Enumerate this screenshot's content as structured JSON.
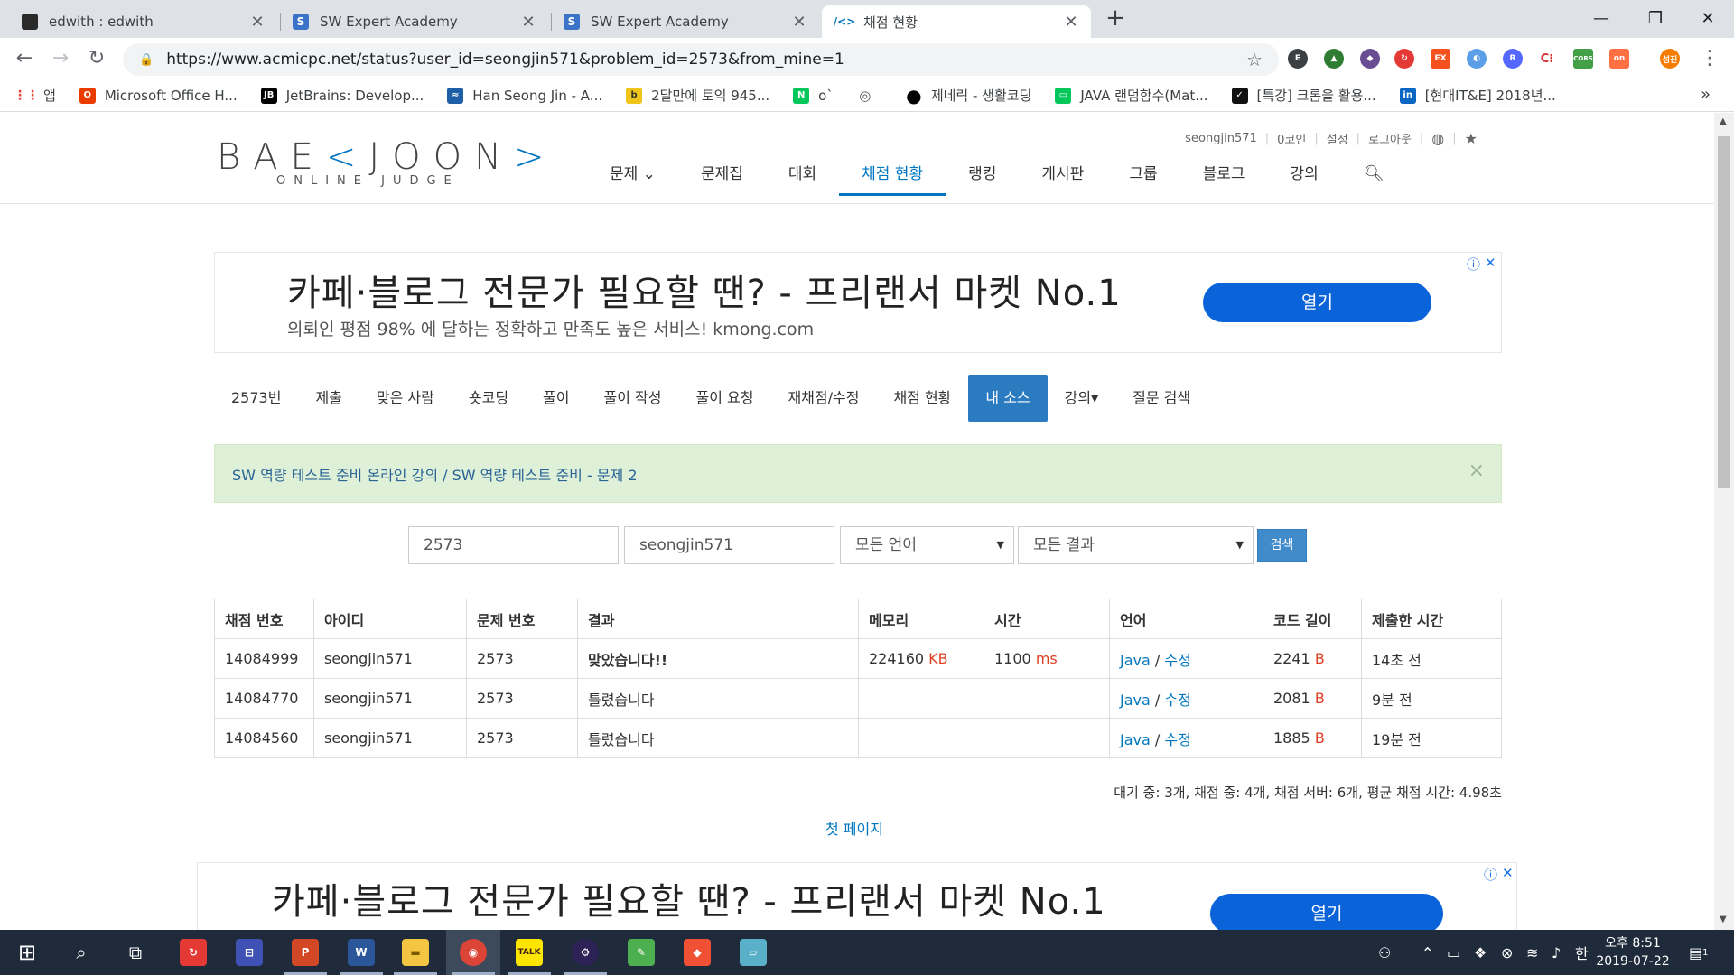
{
  "browser": {
    "tabs": [
      {
        "title": "edwith : edwith",
        "icon": "edwith-icon",
        "color": "#2a2a2a",
        "glyph": ""
      },
      {
        "title": "SW Expert Academy",
        "icon": "swea-icon",
        "color": "#3b73c8",
        "glyph": "S"
      },
      {
        "title": "SW Expert Academy",
        "icon": "swea-icon",
        "color": "#3b73c8",
        "glyph": "S"
      },
      {
        "title": "채점 현황",
        "icon": "baekjoon-icon",
        "color": "#0076c0",
        "glyph": "/<>"
      }
    ],
    "url": "https://www.acmicpc.net/status?user_id=seongjin571&problem_id=2573&from_mine=1",
    "bookmarks": [
      {
        "label": "앱",
        "icon": "apps-icon",
        "color": "#e94235",
        "glyph": "⋮⋮"
      },
      {
        "label": "Microsoft Office H...",
        "icon": "office-icon",
        "color": "#eb3c00",
        "glyph": "O"
      },
      {
        "label": "JetBrains: Develop...",
        "icon": "jetbrains-icon",
        "color": "#000000",
        "glyph": "JB"
      },
      {
        "label": "Han Seong Jin - A...",
        "icon": "codility-icon",
        "color": "#1f5fa8",
        "glyph": "≈"
      },
      {
        "label": "2달만에 토익 945...",
        "icon": "blog-icon",
        "color": "#f0c419",
        "glyph": "b"
      },
      {
        "label": "o`",
        "icon": "naver-icon",
        "color": "#03c75a",
        "glyph": "N"
      },
      {
        "label": "",
        "icon": "globe-icon",
        "color": "#555555",
        "glyph": "◎"
      },
      {
        "label": "제네릭 - 생활코딩",
        "icon": "opentutorials-icon",
        "color": "#000000",
        "glyph": "●"
      },
      {
        "label": "JAVA 랜덤함수(Mat...",
        "icon": "naverblog-icon",
        "color": "#03c75a",
        "glyph": "▭"
      },
      {
        "label": "[특강] 크롬을 활용...",
        "icon": "inflearn-icon",
        "color": "#111111",
        "glyph": "✓"
      },
      {
        "label": "[현대IT&E] 2018년...",
        "icon": "linkedin-icon",
        "color": "#0a66c2",
        "glyph": "in"
      }
    ],
    "window_controls": [
      "—",
      "❐",
      "✕"
    ]
  },
  "site": {
    "logo_main_1": "BAE",
    "logo_main_2": "K",
    "logo_main_3": "JOON",
    "logo_sub": "ONLINE JUDGE",
    "user_menu": [
      "seongjin571",
      "0코인",
      "설정",
      "로그아웃"
    ],
    "main_nav": [
      {
        "label": "문제 ⌄",
        "active": false
      },
      {
        "label": "문제집",
        "active": false
      },
      {
        "label": "대회",
        "active": false
      },
      {
        "label": "채점 현황",
        "active": true
      },
      {
        "label": "랭킹",
        "active": false
      },
      {
        "label": "게시판",
        "active": false
      },
      {
        "label": "그룹",
        "active": false
      },
      {
        "label": "블로그",
        "active": false
      },
      {
        "label": "강의",
        "active": false
      }
    ]
  },
  "ad_top": {
    "headline": "카페·블로그 전문가 필요할 땐? - 프리랜서 마켓 No.1",
    "subline": "의뢰인 평점 98% 에 달하는 정확하고 만족도 높은 서비스! kmong.com",
    "button": "열기"
  },
  "ad_bottom": {
    "headline": "카페·블로그 전문가 필요할 땐? - 프리랜서 마켓 No.1",
    "button": "열기"
  },
  "problem_menu": [
    {
      "label": "2573번",
      "active": false
    },
    {
      "label": "제출",
      "active": false
    },
    {
      "label": "맞은 사람",
      "active": false
    },
    {
      "label": "숏코딩",
      "active": false
    },
    {
      "label": "풀이",
      "active": false
    },
    {
      "label": "풀이 작성",
      "active": false
    },
    {
      "label": "풀이 요청",
      "active": false
    },
    {
      "label": "재채점/수정",
      "active": false
    },
    {
      "label": "채점 현황",
      "active": false
    },
    {
      "label": "내 소스",
      "active": true
    },
    {
      "label": "강의▾",
      "active": false
    },
    {
      "label": "질문 검색",
      "active": false
    }
  ],
  "alert": {
    "link1": "SW 역량 테스트 준비 온라인 강의",
    "sep": " / ",
    "link2": "SW 역량 테스트 준비 - 문제 2",
    "close": "×"
  },
  "search": {
    "problem_id": "2573",
    "user_id": "seongjin571",
    "language": "모든 언어",
    "result": "모든 결과",
    "button": "검색"
  },
  "table": {
    "headers": [
      "채점 번호",
      "아이디",
      "문제 번호",
      "결과",
      "메모리",
      "시간",
      "언어",
      "코드 길이",
      "제출한 시간"
    ],
    "rows": [
      {
        "id": "14084999",
        "user": "seongjin571",
        "problem": "2573",
        "result": "맞았습니다!!",
        "status": "ac",
        "memory": "224160",
        "memory_unit": "KB",
        "time": "1100",
        "time_unit": "ms",
        "lang": "Java",
        "edit": "수정",
        "length": "2241",
        "length_unit": "B",
        "submitted": "14초 전"
      },
      {
        "id": "14084770",
        "user": "seongjin571",
        "problem": "2573",
        "result": "틀렸습니다",
        "status": "wa",
        "memory": "",
        "memory_unit": "",
        "time": "",
        "time_unit": "",
        "lang": "Java",
        "edit": "수정",
        "length": "2081",
        "length_unit": "B",
        "submitted": "9분 전"
      },
      {
        "id": "14084560",
        "user": "seongjin571",
        "problem": "2573",
        "result": "틀렸습니다",
        "status": "wa",
        "memory": "",
        "memory_unit": "",
        "time": "",
        "time_unit": "",
        "lang": "Java",
        "edit": "수정",
        "length": "1885",
        "length_unit": "B",
        "submitted": "19분 전"
      }
    ]
  },
  "stats": "대기 중: 3개, 채점 중: 4개, 채점 서버: 6개, 평균 채점 시간: 4.98초",
  "pagination": "첫 페이지",
  "taskbar": {
    "time": "오후 8:51",
    "date": "2019-07-22",
    "ime": "한",
    "notification_count": "1"
  }
}
